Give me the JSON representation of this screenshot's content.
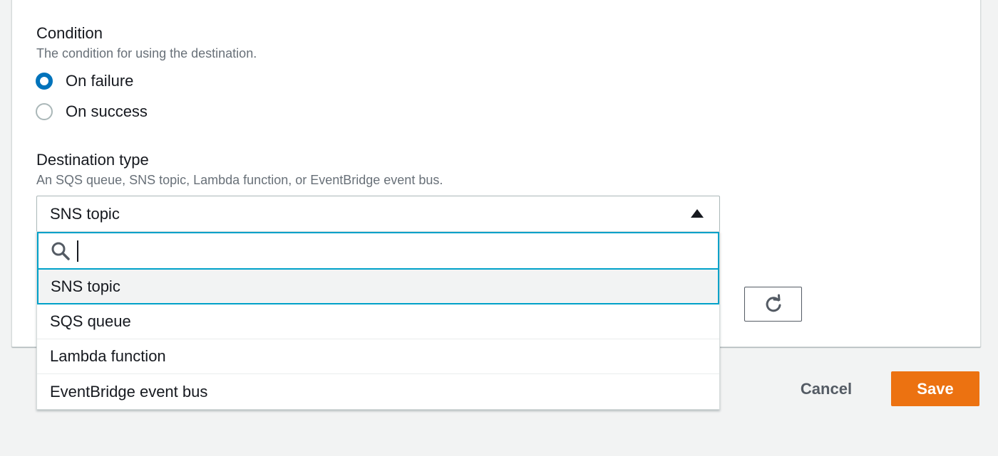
{
  "condition": {
    "label": "Condition",
    "description": "The condition for using the destination.",
    "options": [
      {
        "label": "On failure",
        "checked": true
      },
      {
        "label": "On success",
        "checked": false
      }
    ]
  },
  "destination_type": {
    "label": "Destination type",
    "description": "An SQS queue, SNS topic, Lambda function, or EventBridge event bus.",
    "selected": "SNS topic",
    "search_value": "",
    "options": [
      {
        "label": "SNS topic",
        "highlighted": true
      },
      {
        "label": "SQS queue"
      },
      {
        "label": "Lambda function"
      },
      {
        "label": "EventBridge event bus"
      }
    ]
  },
  "icons": {
    "caret": "caret-up-icon",
    "search": "search-icon",
    "refresh": "refresh-icon"
  },
  "footer": {
    "cancel_label": "Cancel",
    "save_label": "Save"
  },
  "colors": {
    "accent": "#0073bb",
    "focus": "#00a1c9",
    "primary_button": "#ec7211"
  }
}
